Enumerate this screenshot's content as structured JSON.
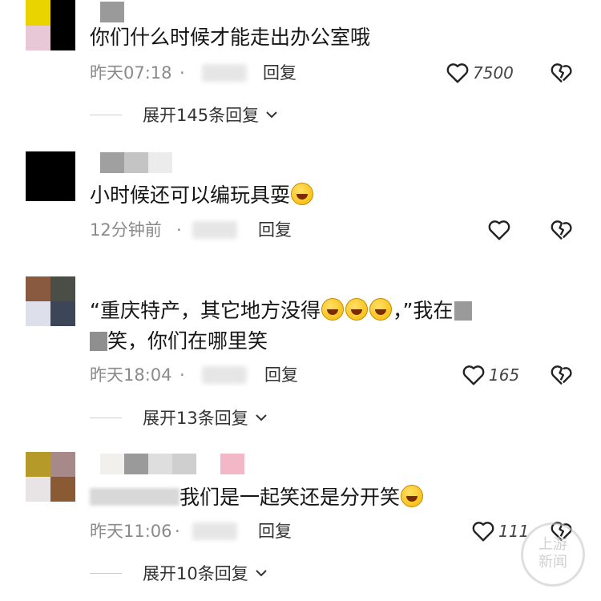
{
  "comments": [
    {
      "text": "你们什么时候才能走出办公室哦",
      "time": "昨天07:18",
      "dot": "·",
      "reply": "回复",
      "likes": "7500",
      "expand": "展开145条回复"
    },
    {
      "text": "小时候还可以编玩具耍",
      "time": "12分钟前",
      "dot": "·",
      "reply": "回复",
      "likes": "",
      "expand": ""
    },
    {
      "text_line1": "“重庆特产，其它地方没得",
      "text_line1_end": "，”我在",
      "text_line2": "笑，你们在哪里笑",
      "time": "昨天18:04",
      "dot": "·",
      "reply": "回复",
      "likes": "165",
      "expand": "展开13条回复"
    },
    {
      "text": "我们是一起笑还是分开笑",
      "time": "昨天11:06",
      "dot": "·",
      "reply": "回复",
      "likes": "111",
      "expand": "展开10条回复"
    }
  ],
  "watermark": {
    "line1": "上游",
    "line2": "新闻"
  },
  "icons": {
    "like": "heart-outline-icon",
    "dislike": "broken-heart-icon",
    "expand": "chevron-down-icon",
    "emoji": "rolling-on-floor-laughing-emoji"
  },
  "colors": {
    "text": "#161616",
    "meta": "#8a8a8a",
    "reply": "#333333"
  }
}
